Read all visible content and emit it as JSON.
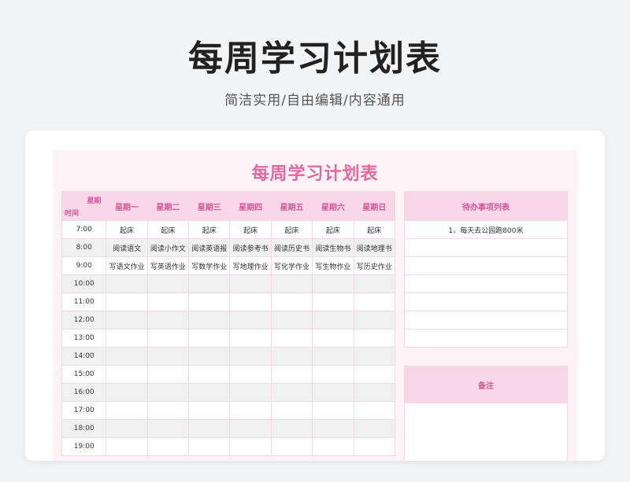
{
  "header": {
    "title": "每周学习计划表",
    "subtitle": "简洁实用/自由编辑/内容通用"
  },
  "sheet": {
    "title": "每周学习计划表",
    "corner_top": "星期",
    "corner_bottom": "时间",
    "days": [
      "星期一",
      "星期二",
      "星期三",
      "星期四",
      "星期五",
      "星期六",
      "星期日"
    ],
    "rows": [
      {
        "time": "7:00",
        "cells": [
          "起床",
          "起床",
          "起床",
          "起床",
          "起床",
          "起床",
          "起床"
        ]
      },
      {
        "time": "8:00",
        "cells": [
          "阅读语文",
          "阅读小作文",
          "阅读英语报",
          "阅读参考书",
          "阅读历史书",
          "阅读生物书",
          "阅读地理书"
        ]
      },
      {
        "time": "9:00",
        "cells": [
          "写语文作业",
          "写英语作业",
          "写数学作业",
          "写地理作业",
          "写化学作业",
          "写生物作业",
          "写历史作业"
        ]
      },
      {
        "time": "10:00",
        "cells": [
          "",
          "",
          "",
          "",
          "",
          "",
          ""
        ]
      },
      {
        "time": "11:00",
        "cells": [
          "",
          "",
          "",
          "",
          "",
          "",
          ""
        ]
      },
      {
        "time": "12:00",
        "cells": [
          "",
          "",
          "",
          "",
          "",
          "",
          ""
        ]
      },
      {
        "time": "13:00",
        "cells": [
          "",
          "",
          "",
          "",
          "",
          "",
          ""
        ]
      },
      {
        "time": "14:00",
        "cells": [
          "",
          "",
          "",
          "",
          "",
          "",
          ""
        ]
      },
      {
        "time": "15:00",
        "cells": [
          "",
          "",
          "",
          "",
          "",
          "",
          ""
        ]
      },
      {
        "time": "16:00",
        "cells": [
          "",
          "",
          "",
          "",
          "",
          "",
          ""
        ]
      },
      {
        "time": "17:00",
        "cells": [
          "",
          "",
          "",
          "",
          "",
          "",
          ""
        ]
      },
      {
        "time": "18:00",
        "cells": [
          "",
          "",
          "",
          "",
          "",
          "",
          ""
        ]
      },
      {
        "time": "19:00",
        "cells": [
          "",
          "",
          "",
          "",
          "",
          "",
          ""
        ]
      }
    ],
    "todo": {
      "header": "待办事项列表",
      "items": [
        "1、每天去公园跑800米",
        "",
        "",
        "",
        "",
        "",
        ""
      ]
    },
    "notes": {
      "header": "备注",
      "body": ""
    }
  }
}
